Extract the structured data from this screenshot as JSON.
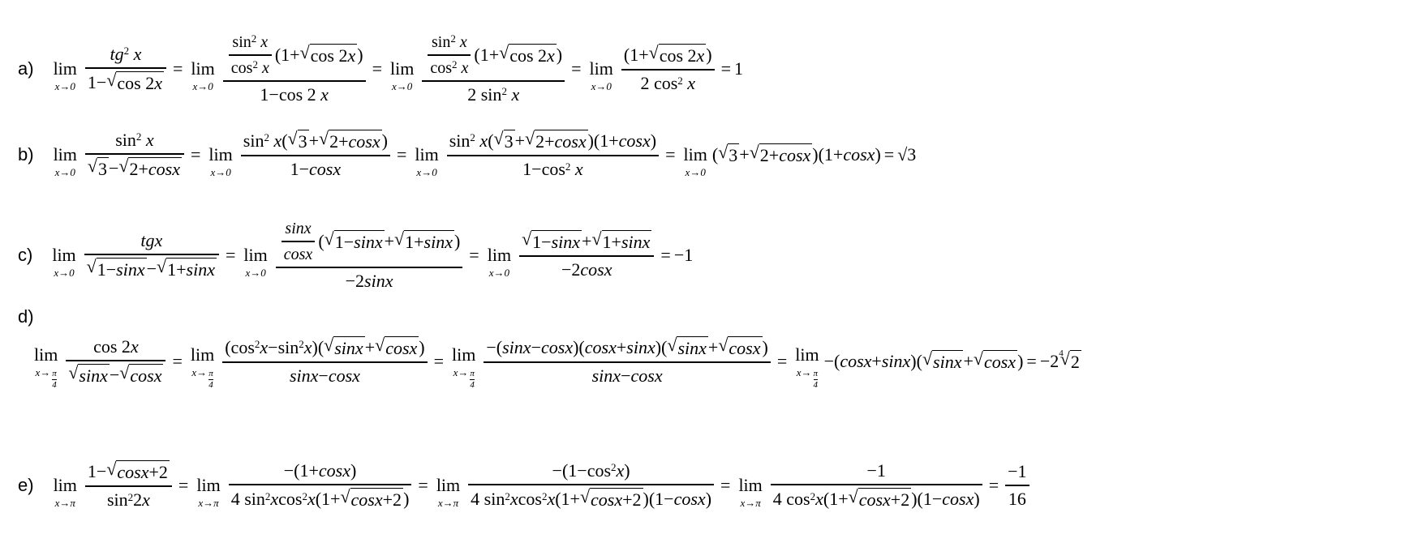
{
  "labels": {
    "a": "a)",
    "b": "b)",
    "c": "c)",
    "d": "d)",
    "e": "e)"
  },
  "lim": "lim",
  "sub_x0": "x→0",
  "sub_xpi": "x→π",
  "sub_xpi4_prefix": "x→",
  "pi": "π",
  "four": "4",
  "results": {
    "a": "1",
    "b": "√3",
    "c": "−1",
    "d": "−2",
    "d_root_index": "4",
    "d_root_arg": "2",
    "e_num": "−1",
    "e_den": "16"
  }
}
